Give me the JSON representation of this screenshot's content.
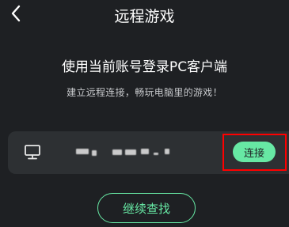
{
  "header": {
    "title": "远程游戏",
    "back_icon": "chevron-left-icon"
  },
  "main": {
    "heading": "使用当前账号登录PC客户端",
    "subtitle": "建立远程连接，畅玩电脑里的游戏！"
  },
  "pc_card": {
    "icon": "monitor-icon",
    "device_name_redacted": true,
    "connect_label": "连接"
  },
  "footer": {
    "continue_label": "继续查找"
  },
  "colors": {
    "background": "#1e2023",
    "card": "#2d3033",
    "accent": "#67e8a4",
    "highlight": "#ff0000"
  }
}
